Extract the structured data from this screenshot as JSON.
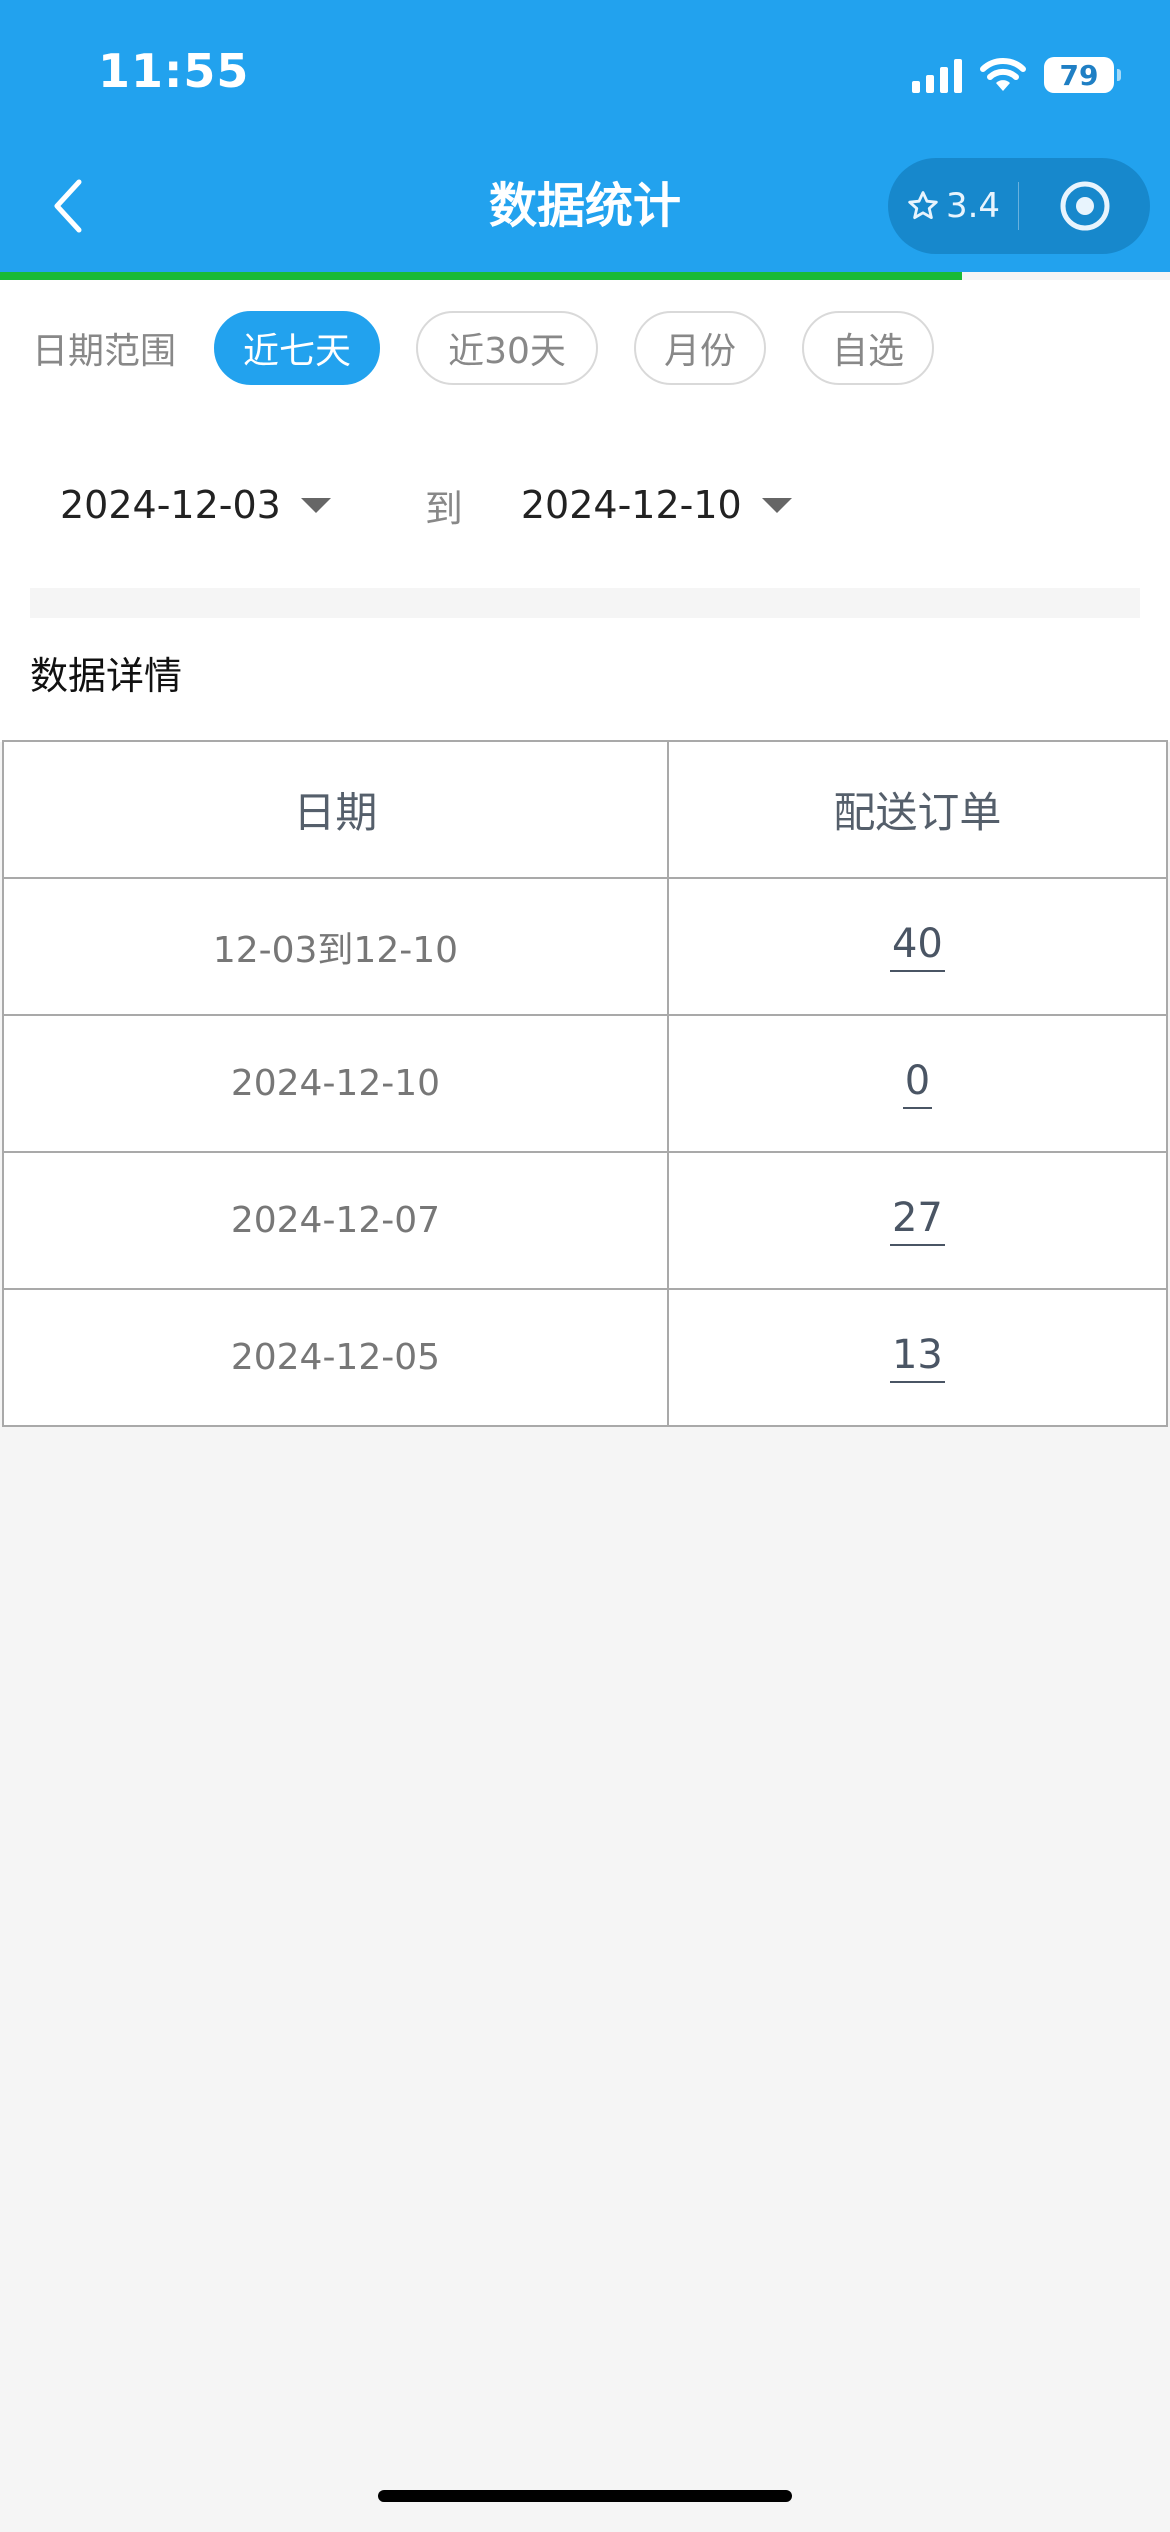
{
  "status_bar": {
    "time": "11:55",
    "battery": "79"
  },
  "nav": {
    "title": "数据统计",
    "rating": "3.4"
  },
  "filter": {
    "label": "日期范围",
    "options": [
      "近七天",
      "近30天",
      "月份",
      "自选"
    ],
    "active_index": 0
  },
  "date_range": {
    "start": "2024-12-03",
    "separator": "到",
    "end": "2024-12-10"
  },
  "section_title": "数据详情",
  "table": {
    "headers": [
      "日期",
      "配送订单"
    ],
    "rows": [
      {
        "date": "12-03到12-10",
        "count": "40"
      },
      {
        "date": "2024-12-10",
        "count": "0"
      },
      {
        "date": "2024-12-07",
        "count": "27"
      },
      {
        "date": "2024-12-05",
        "count": "13"
      }
    ]
  },
  "colors": {
    "primary": "#22a2ee",
    "progress": "#19b934",
    "background": "#f5f5f5"
  }
}
